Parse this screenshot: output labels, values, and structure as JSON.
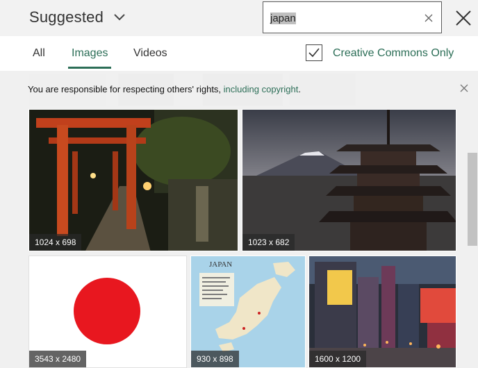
{
  "header": {
    "title": "Suggested",
    "search_query": "japan"
  },
  "tabs": [
    {
      "label": "All",
      "active": false
    },
    {
      "label": "Images",
      "active": true
    },
    {
      "label": "Videos",
      "active": false
    }
  ],
  "filter": {
    "label": "Creative Commons Only",
    "checked": true
  },
  "notice": {
    "text": "You are responsible for respecting others' rights, ",
    "link": "including copyright",
    "suffix": "."
  },
  "results": [
    {
      "dimensions": "1024 x 698",
      "subject": "torii gates at night"
    },
    {
      "dimensions": "1023 x 682",
      "subject": "pagoda with mount fuji"
    },
    {
      "dimensions": "3543 x 2480",
      "subject": "flag of japan"
    },
    {
      "dimensions": "930 x 898",
      "subject": "map of japan"
    },
    {
      "dimensions": "1600 x 1200",
      "subject": "city street at night"
    }
  ],
  "map_title": "JAPAN",
  "colors": {
    "accent": "#2c6e57",
    "flag_red": "#e8171f"
  }
}
